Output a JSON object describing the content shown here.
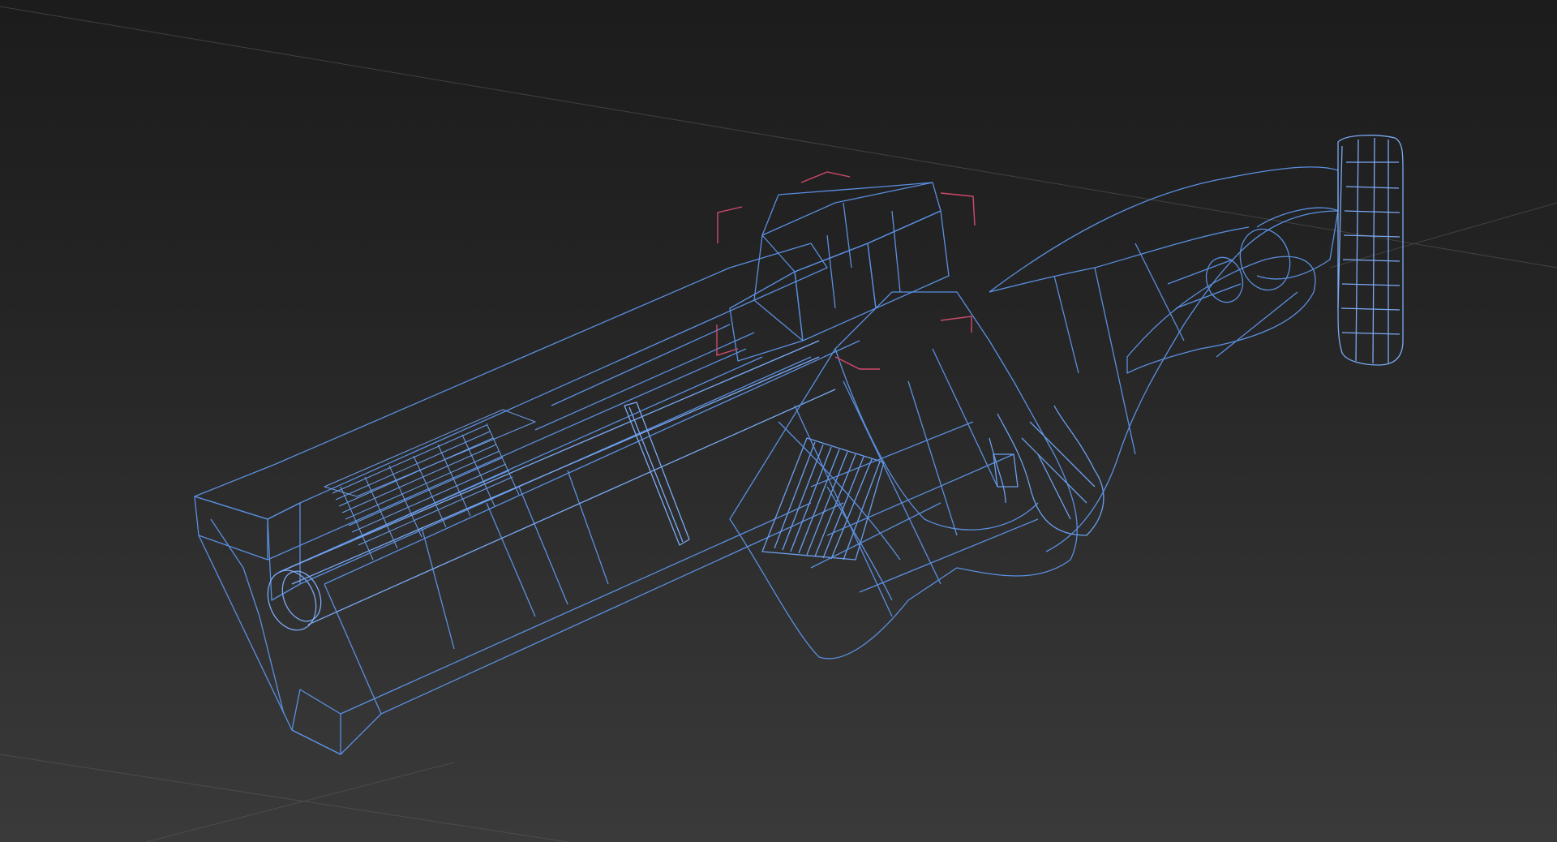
{
  "viewport": {
    "view": "perspective",
    "shading": "wireframe"
  },
  "colors": {
    "background_top": "#1c1c1c",
    "background_bottom": "#3a3a3a",
    "wireframe": "#5a8fe0",
    "wireframe_bright": "#7aaaf5",
    "grid": "#5c5c5c",
    "selection_bracket": "#d04a6e"
  },
  "model": {
    "object": "rifle",
    "shading": "wireframe",
    "selected_part": "scope-mount"
  }
}
